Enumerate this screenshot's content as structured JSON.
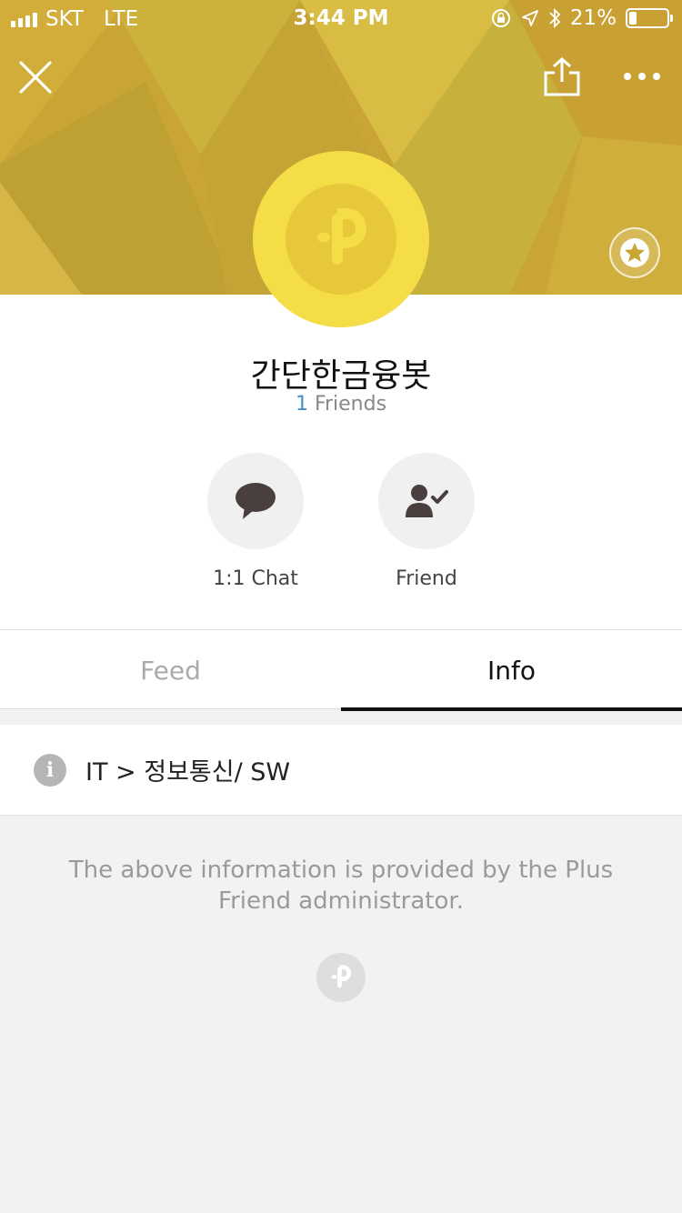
{
  "status_bar": {
    "carrier": "SKT",
    "network": "LTE",
    "time": "3:44 PM",
    "battery": "21%",
    "battery_level": 0.21
  },
  "header": {
    "close_icon": "close-icon",
    "share_icon": "share-icon",
    "more_icon": "more-icon",
    "favorite_icon": "star-icon",
    "banner_colors": [
      "#c9a536",
      "#d4b43e",
      "#b8942f",
      "#e0c24a"
    ]
  },
  "profile": {
    "name": "간단한금융봇",
    "friends_count": "1",
    "friends_label": "Friends",
    "avatar_color": "#f5dd47"
  },
  "actions": {
    "chat_label": "1:1 Chat",
    "friend_label": "Friend"
  },
  "tabs": {
    "feed": "Feed",
    "info": "Info",
    "active": "Info"
  },
  "info": {
    "category": "IT > 정보통신/ SW",
    "notice": "The above information is provided by the Plus Friend administrator."
  }
}
